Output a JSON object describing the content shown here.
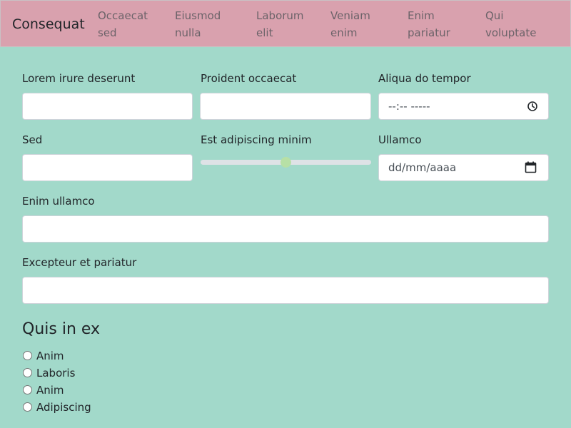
{
  "navbar": {
    "brand": "Consequat",
    "links": [
      {
        "line1": "Occaecat",
        "line2": "sed"
      },
      {
        "line1": "Eiusmod",
        "line2": "nulla"
      },
      {
        "line1": "Laborum",
        "line2": "elit"
      },
      {
        "line1": "Veniam",
        "line2": "enim"
      },
      {
        "line1": "Enim",
        "line2": "pariatur"
      },
      {
        "line1": "Qui",
        "line2": "voluptate"
      }
    ]
  },
  "form": {
    "field1": {
      "label": "Lorem irure deserunt",
      "value": ""
    },
    "field2": {
      "label": "Proident occaecat",
      "value": ""
    },
    "field3": {
      "label": "Aliqua do tempor",
      "placeholder": "--:-- -----"
    },
    "field4": {
      "label": "Sed",
      "value": ""
    },
    "field5": {
      "label": "Est adipiscing minim",
      "value": 0.5
    },
    "field6": {
      "label": "Ullamco",
      "placeholder": "dd/mm/aaaa"
    },
    "field7": {
      "label": "Enim ullamco",
      "value": ""
    },
    "field8": {
      "label": "Excepteur et pariatur",
      "value": ""
    }
  },
  "radio_group": {
    "title": "Quis in ex",
    "options": [
      "Anim",
      "Laboris",
      "Anim",
      "Adipiscing"
    ]
  },
  "colors": {
    "background": "#a2d9ca",
    "navbar": "#d9a1ae",
    "range_thumb": "#b7e0a6"
  }
}
